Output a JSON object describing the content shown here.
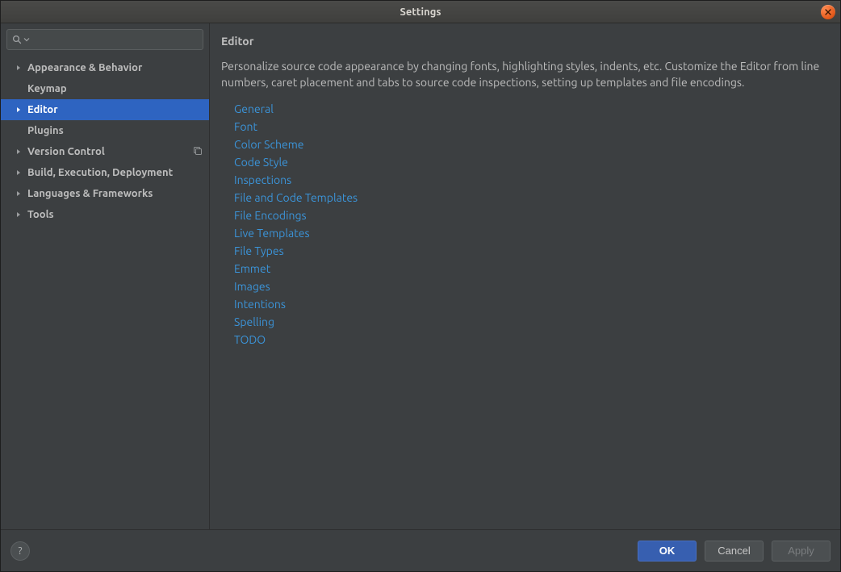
{
  "window": {
    "title": "Settings"
  },
  "search": {
    "placeholder": ""
  },
  "sidebar": {
    "items": [
      {
        "label": "Appearance & Behavior",
        "expandable": true,
        "selected": false,
        "badge": false
      },
      {
        "label": "Keymap",
        "expandable": false,
        "selected": false,
        "badge": false
      },
      {
        "label": "Editor",
        "expandable": true,
        "selected": true,
        "badge": false
      },
      {
        "label": "Plugins",
        "expandable": false,
        "selected": false,
        "badge": false
      },
      {
        "label": "Version Control",
        "expandable": true,
        "selected": false,
        "badge": true
      },
      {
        "label": "Build, Execution, Deployment",
        "expandable": true,
        "selected": false,
        "badge": false
      },
      {
        "label": "Languages & Frameworks",
        "expandable": true,
        "selected": false,
        "badge": false
      },
      {
        "label": "Tools",
        "expandable": true,
        "selected": false,
        "badge": false
      }
    ]
  },
  "main": {
    "title": "Editor",
    "description": "Personalize source code appearance by changing fonts, highlighting styles, indents, etc. Customize the Editor from line numbers, caret placement and tabs to source code inspections, setting up templates and file encodings.",
    "links": [
      "General",
      "Font",
      "Color Scheme",
      "Code Style",
      "Inspections",
      "File and Code Templates",
      "File Encodings",
      "Live Templates",
      "File Types",
      "Emmet",
      "Images",
      "Intentions",
      "Spelling",
      "TODO"
    ]
  },
  "footer": {
    "ok": "OK",
    "cancel": "Cancel",
    "apply": "Apply",
    "help": "?"
  }
}
